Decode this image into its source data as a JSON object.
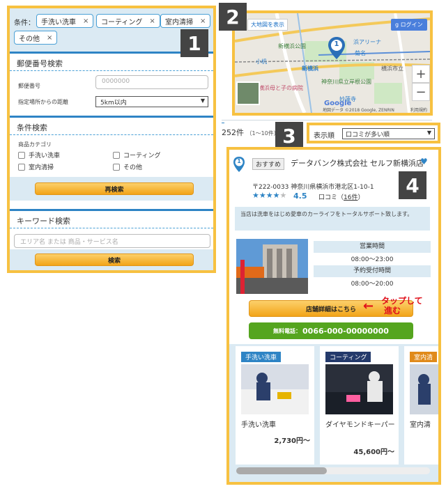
{
  "panel1": {
    "badge": "1",
    "conditions_label": "条件：",
    "chips": [
      {
        "label": "手洗い洗車",
        "remove": "×"
      },
      {
        "label": "コーティング",
        "remove": "×"
      },
      {
        "label": "室内清掃",
        "remove": "×"
      },
      {
        "label": "その他",
        "remove": "×"
      }
    ],
    "postal_section_title": "郵便番号検索",
    "postal_label": "郵便番号",
    "postal_placeholder": "0000000",
    "distance_label": "指定場所からの距離",
    "distance_value": "5km以内",
    "condition_section_title": "条件検索",
    "category_label": "商品カテゴリ",
    "categories": [
      "手洗い洗車",
      "コーティング",
      "室内清掃",
      "その他"
    ],
    "research_button": "再検索",
    "keyword_section_title": "キーワード検索",
    "keyword_placeholder": "エリア名 または 商品・サービス名",
    "search_button": "検索"
  },
  "panel2": {
    "badge": "2",
    "large_map_link": "大地図を表示",
    "login": "ログイン",
    "google_g": "g",
    "pin_number": "1",
    "labels": {
      "arena": "浜アリーナ",
      "kikuna": "菊名",
      "shin_yokohama_park": "新横浜公園",
      "kozukue": "小机",
      "shin_yokohama": "新横浜",
      "yokohama_city": "横浜市立",
      "hospital": "横浜母と子の病院",
      "kishine": "神奈川県立岸根公園",
      "myorenji": "妙蓮寺",
      "copyright": "地図データ ©2018 Google, ZENRIN",
      "terms": "利用規約",
      "google": "Google"
    },
    "zoom_in": "+",
    "zoom_out": "−"
  },
  "results": {
    "count": "252件",
    "range": "（1～10件）"
  },
  "panel3": {
    "badge": "3",
    "sort_label": "表示順",
    "sort_value": "口コミが多い順"
  },
  "panel4": {
    "badge": "4",
    "pin_number": "1",
    "recommend_tag": "おすすめ",
    "shop_name": "データバンク株式会社 セルフ新横浜店",
    "address": "〒222-0033 神奈川県横浜市港北区1-10-1",
    "stars": 4.5,
    "stars_on": "★★★★",
    "stars_off": "★",
    "rating": "4.5",
    "review_label": "口コミ（",
    "review_count": "16件",
    "review_close": "）",
    "description": "当店は洗車をはじめ愛車のカーライフをトータルサポート致します。",
    "hours_title": "営業時間",
    "hours_value": "08:00～23:00",
    "reserve_title": "予約受付時間",
    "reserve_value": "08:00～20:00",
    "detail_button": "店舗詳細はこちら",
    "tap_note_line1": "タップして",
    "tap_note_line2": "進む",
    "tap_arrow": "←",
    "phone_prefix": "無料電話：",
    "phone_number": "0066-000-00000000",
    "products": [
      {
        "tag": "手洗い洗車",
        "tag_color": "#2e84c5",
        "name": "手洗い洗車",
        "price": "2,730円～"
      },
      {
        "tag": "コーティング",
        "tag_color": "#243a6b",
        "name": "ダイヤモンドキーパー",
        "price": "45,600円～"
      },
      {
        "tag": "室内清",
        "tag_color": "#e08a1a",
        "name": "室内清",
        "price": ""
      }
    ],
    "colors": {
      "accent": "#2e84c5",
      "orange": "#f2a418",
      "green": "#55a51f",
      "highlight": "#f7c141"
    }
  }
}
